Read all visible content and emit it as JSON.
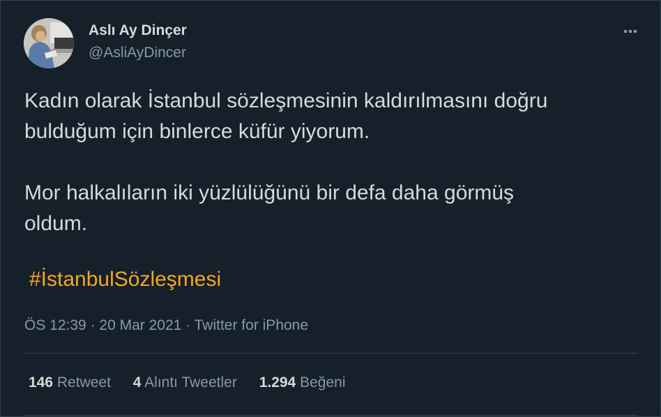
{
  "author": {
    "name": "Aslı Ay Dinçer",
    "handle": "@AsliAyDincer"
  },
  "tweet": {
    "paragraph1_line1": "Kadın olarak İstanbul sözleşmesinin kaldırılmasını doğru",
    "paragraph1_line2": "bulduğum için binlerce küfür yiyorum.",
    "paragraph2_line1": "Mor halkalıların iki yüzlülüğünü bir defa daha görmüş",
    "paragraph2_line2": "oldum.",
    "hashtag": "#İstanbulSözleşmesi"
  },
  "meta": {
    "time": "ÖS 12:39",
    "separator1": " · ",
    "date": "20 Mar 2021",
    "separator2": " · ",
    "source": "Twitter for iPhone"
  },
  "stats": {
    "retweets_count": "146",
    "retweets_label": "Retweet",
    "quotes_count": "4",
    "quotes_label": "Alıntı Tweetler",
    "likes_count": "1.294",
    "likes_label": "Beğeni"
  },
  "icons": {
    "more": "more-horizontal-icon"
  },
  "colors": {
    "background": "#15202b",
    "text": "#d9d9d9",
    "secondary": "#8899a6",
    "hashtag": "#f5a621",
    "border": "#38444d"
  }
}
